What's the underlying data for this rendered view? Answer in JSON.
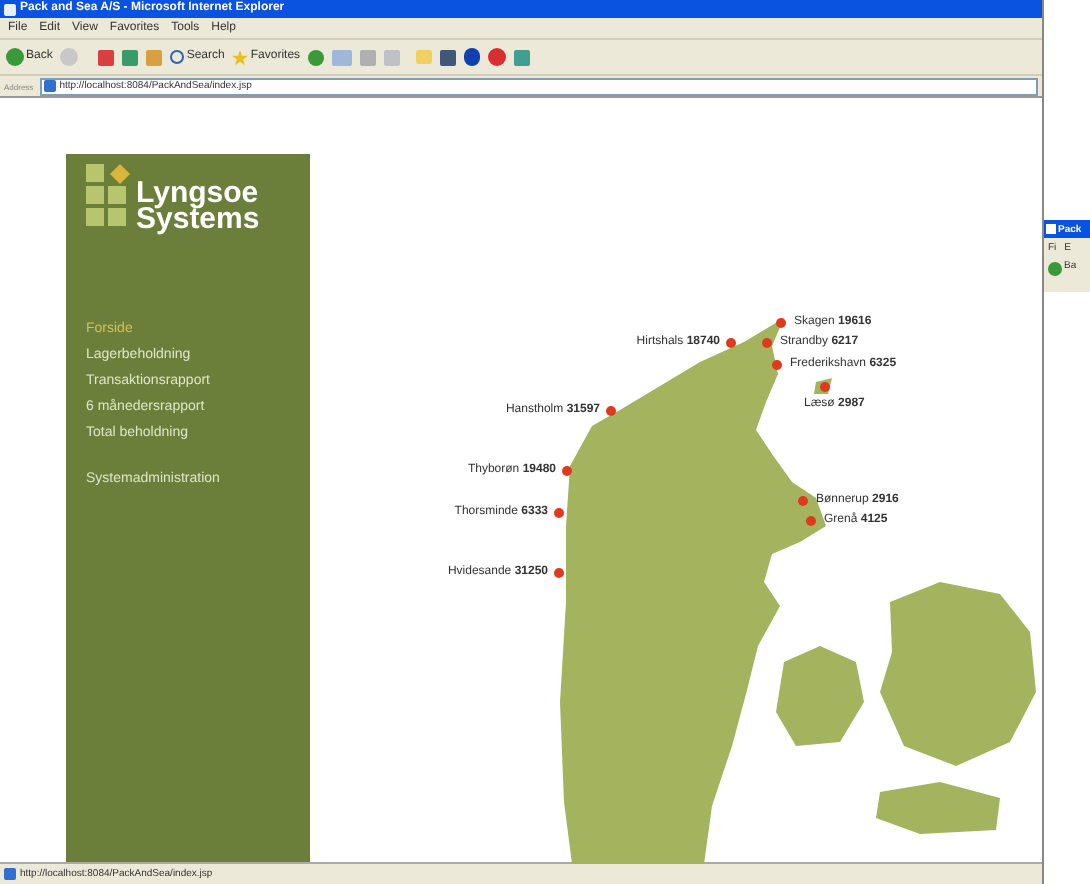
{
  "window": {
    "title": "Pack and Sea A/S - Microsoft Internet Explorer"
  },
  "menu_bar": [
    "File",
    "Edit",
    "View",
    "Favorites",
    "Tools",
    "Help"
  ],
  "toolbar": {
    "back": "Back",
    "search": "Search",
    "favorites": "Favorites"
  },
  "address_bar": {
    "label": "Address",
    "value": "http://localhost:8084/PackAndSea/index.jsp"
  },
  "logo": {
    "line_1": "Lyngsoe",
    "line_2": "Systems"
  },
  "nav_groups": [
    [
      {
        "label": "Forside",
        "selected": true
      },
      {
        "label": "Lagerbeholdning",
        "selected": false
      },
      {
        "label": "Transaktionsrapport",
        "selected": false
      },
      {
        "label": "6 månedersrapport",
        "selected": false
      },
      {
        "label": "Total beholdning",
        "selected": false
      }
    ],
    [
      {
        "label": "Systemadministration",
        "selected": false
      }
    ]
  ],
  "map_pins": [
    {
      "name": "Skagen",
      "value": "19616"
    },
    {
      "name": "Hirtshals",
      "value": "18740"
    },
    {
      "name": "Strandby",
      "value": "6217"
    },
    {
      "name": "Frederikshavn",
      "value": "6325"
    },
    {
      "name": "Læsø",
      "value": "2987"
    },
    {
      "name": "Hanstholm",
      "value": "31597"
    },
    {
      "name": "Thyborøn",
      "value": "19480"
    },
    {
      "name": "Bønnerup",
      "value": "2916"
    },
    {
      "name": "Thorsminde",
      "value": "6333"
    },
    {
      "name": "Grenå",
      "value": "4125"
    },
    {
      "name": "Hvidesande",
      "value": "31250"
    }
  ],
  "status_bar": {
    "text": "http://localhost:8084/PackAndSea/index.jsp"
  },
  "second_window": {
    "title": "Pack",
    "menu": [
      "Fi",
      "E"
    ],
    "back": "Ba"
  }
}
